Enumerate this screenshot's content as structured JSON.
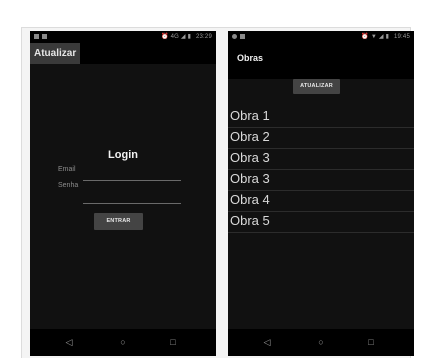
{
  "login_screen": {
    "status": {
      "icons": [
        "image-icon",
        "square-icon"
      ],
      "right": "⏰ 4G ◢ ▮",
      "time": "23:29"
    },
    "toolbar_button": "Atualizar",
    "title": "Login",
    "email_label": "Email",
    "senha_label": "Senha",
    "submit_label": "ENTRAR"
  },
  "obras_screen": {
    "status": {
      "icons": [
        "circle-icon",
        "square-icon"
      ],
      "right": "⏰ ▼ ◢ ▮",
      "time": "19:45"
    },
    "title": "Obras",
    "refresh_label": "ATUALIZAR",
    "items": [
      "Obra 1",
      "Obra 2",
      "Obra 3",
      "Obra 3",
      "Obra 4",
      "Obra 5"
    ]
  },
  "nav_icons": {
    "back": "◁",
    "home": "○",
    "recents": "□"
  }
}
